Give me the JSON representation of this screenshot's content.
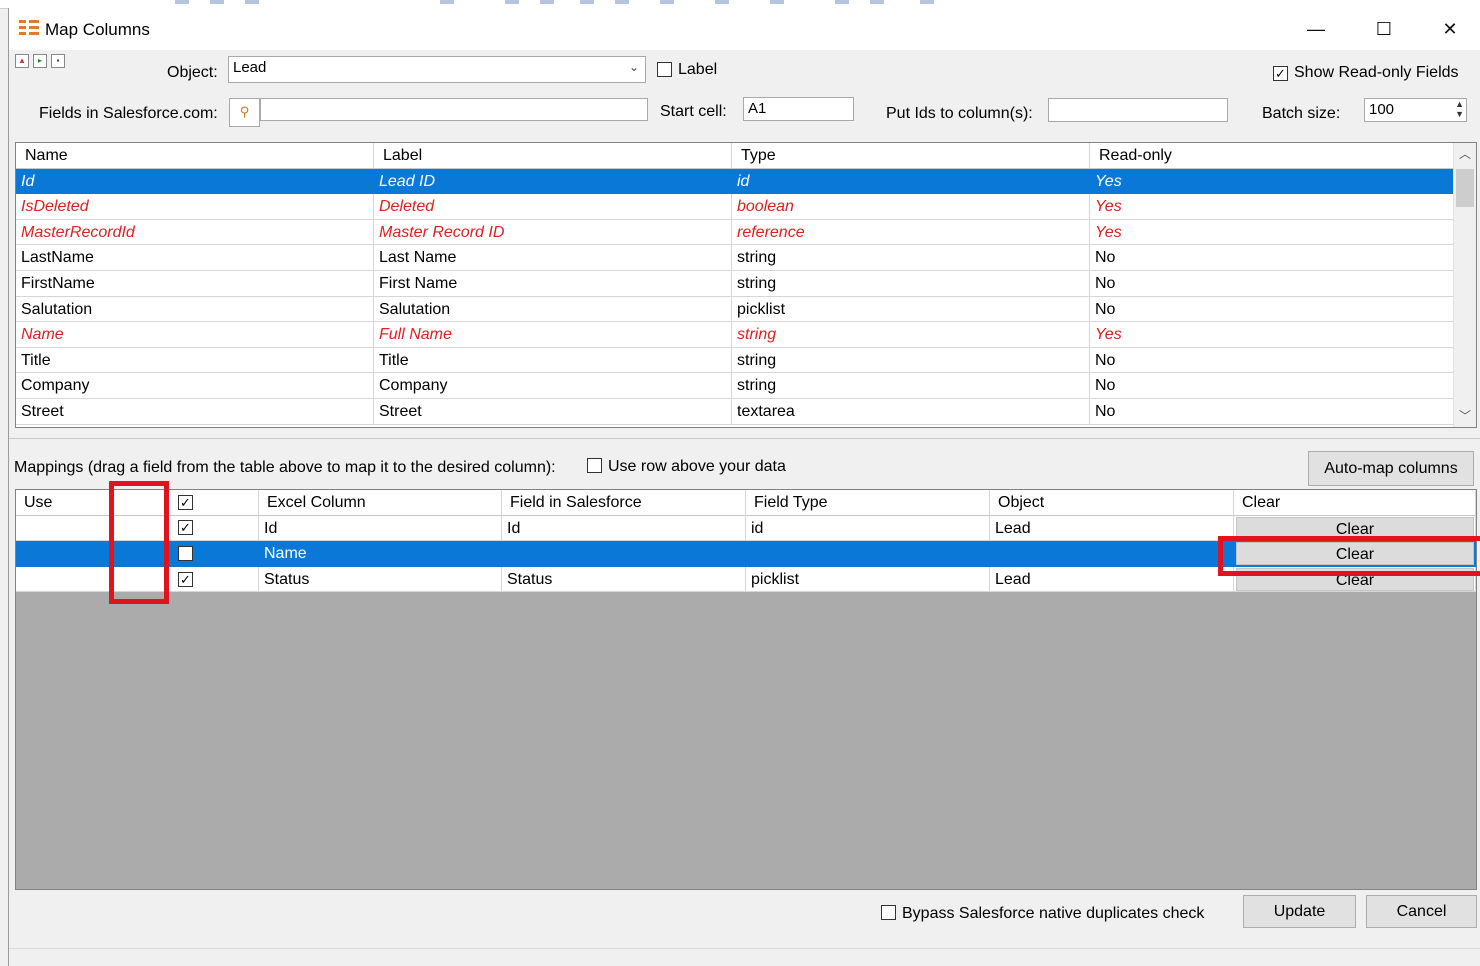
{
  "window": {
    "title": "Map Columns",
    "minimize_glyph": "—",
    "maximize_glyph": "☐",
    "close_glyph": "✕"
  },
  "form": {
    "object_label": "Object:",
    "object_value": "Lead",
    "label_checkbox_label": "Label",
    "label_checked": false,
    "show_readonly_label": "Show Read-only Fields",
    "show_readonly_checked": true,
    "fields_label": "Fields in Salesforce.com:",
    "fields_search_value": "",
    "start_cell_label": "Start cell:",
    "start_cell_value": "A1",
    "put_ids_label": "Put Ids to column(s):",
    "put_ids_value": "",
    "batch_size_label": "Batch size:",
    "batch_size_value": "100"
  },
  "fields_table": {
    "columns": [
      "Name",
      "Label",
      "Type",
      "Read-only"
    ],
    "rows": [
      {
        "name": "Id",
        "label": "Lead ID",
        "type": "id",
        "readonly": "Yes",
        "is_readonly": true,
        "selected": true
      },
      {
        "name": "IsDeleted",
        "label": "Deleted",
        "type": "boolean",
        "readonly": "Yes",
        "is_readonly": true,
        "selected": false
      },
      {
        "name": "MasterRecordId",
        "label": "Master Record ID",
        "type": "reference",
        "readonly": "Yes",
        "is_readonly": true,
        "selected": false
      },
      {
        "name": "LastName",
        "label": "Last Name",
        "type": "string",
        "readonly": "No",
        "is_readonly": false,
        "selected": false
      },
      {
        "name": "FirstName",
        "label": "First Name",
        "type": "string",
        "readonly": "No",
        "is_readonly": false,
        "selected": false
      },
      {
        "name": "Salutation",
        "label": "Salutation",
        "type": "picklist",
        "readonly": "No",
        "is_readonly": false,
        "selected": false
      },
      {
        "name": "Name",
        "label": "Full Name",
        "type": "string",
        "readonly": "Yes",
        "is_readonly": true,
        "selected": false
      },
      {
        "name": "Title",
        "label": "Title",
        "type": "string",
        "readonly": "No",
        "is_readonly": false,
        "selected": false
      },
      {
        "name": "Company",
        "label": "Company",
        "type": "string",
        "readonly": "No",
        "is_readonly": false,
        "selected": false
      },
      {
        "name": "Street",
        "label": "Street",
        "type": "textarea",
        "readonly": "No",
        "is_readonly": false,
        "selected": false
      }
    ]
  },
  "mappings": {
    "instruction": "Mappings (drag a field from the table above to map it to the desired column):",
    "use_row_above_label": "Use row above your data",
    "use_row_above_checked": false,
    "automap_label": "Auto-map columns",
    "header_all_checked": true,
    "columns": [
      "Use",
      "Excel Column",
      "Field in Salesforce",
      "Field Type",
      "Object",
      "Clear"
    ],
    "rows": [
      {
        "use": true,
        "excel_column": "Id",
        "field": "Id",
        "field_type": "id",
        "object": "Lead",
        "clear_label": "Clear",
        "selected": false
      },
      {
        "use": false,
        "excel_column": "Name",
        "field": "",
        "field_type": "",
        "object": "",
        "clear_label": "Clear",
        "selected": true
      },
      {
        "use": true,
        "excel_column": "Status",
        "field": "Status",
        "field_type": "picklist",
        "object": "Lead",
        "clear_label": "Clear",
        "selected": false
      }
    ]
  },
  "footer": {
    "bypass_label": "Bypass Salesforce native duplicates check",
    "bypass_checked": false,
    "update_label": "Update",
    "cancel_label": "Cancel"
  },
  "colors": {
    "selection": "#0a78d7",
    "readonly_text": "#e02020",
    "highlight": "#e0141e",
    "empty_area": "#ababab"
  }
}
